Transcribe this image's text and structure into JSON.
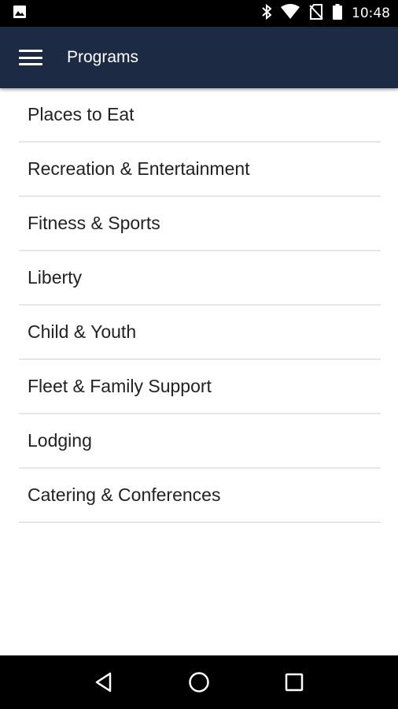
{
  "status_bar": {
    "time": "10:48",
    "icons": [
      "image-notification-icon",
      "bluetooth-icon",
      "wifi-icon",
      "no-sim-icon",
      "battery-icon"
    ]
  },
  "app_bar": {
    "title": "Programs",
    "menu_icon": "hamburger-menu-icon",
    "background_color": "#1c2a44"
  },
  "programs": [
    {
      "label": "Places to Eat"
    },
    {
      "label": "Recreation & Entertainment"
    },
    {
      "label": "Fitness & Sports"
    },
    {
      "label": "Liberty"
    },
    {
      "label": "Child & Youth"
    },
    {
      "label": "Fleet & Family Support"
    },
    {
      "label": "Lodging"
    },
    {
      "label": "Catering & Conferences"
    }
  ],
  "nav_bar": {
    "icons": [
      "back-icon",
      "home-icon",
      "recents-icon"
    ]
  }
}
